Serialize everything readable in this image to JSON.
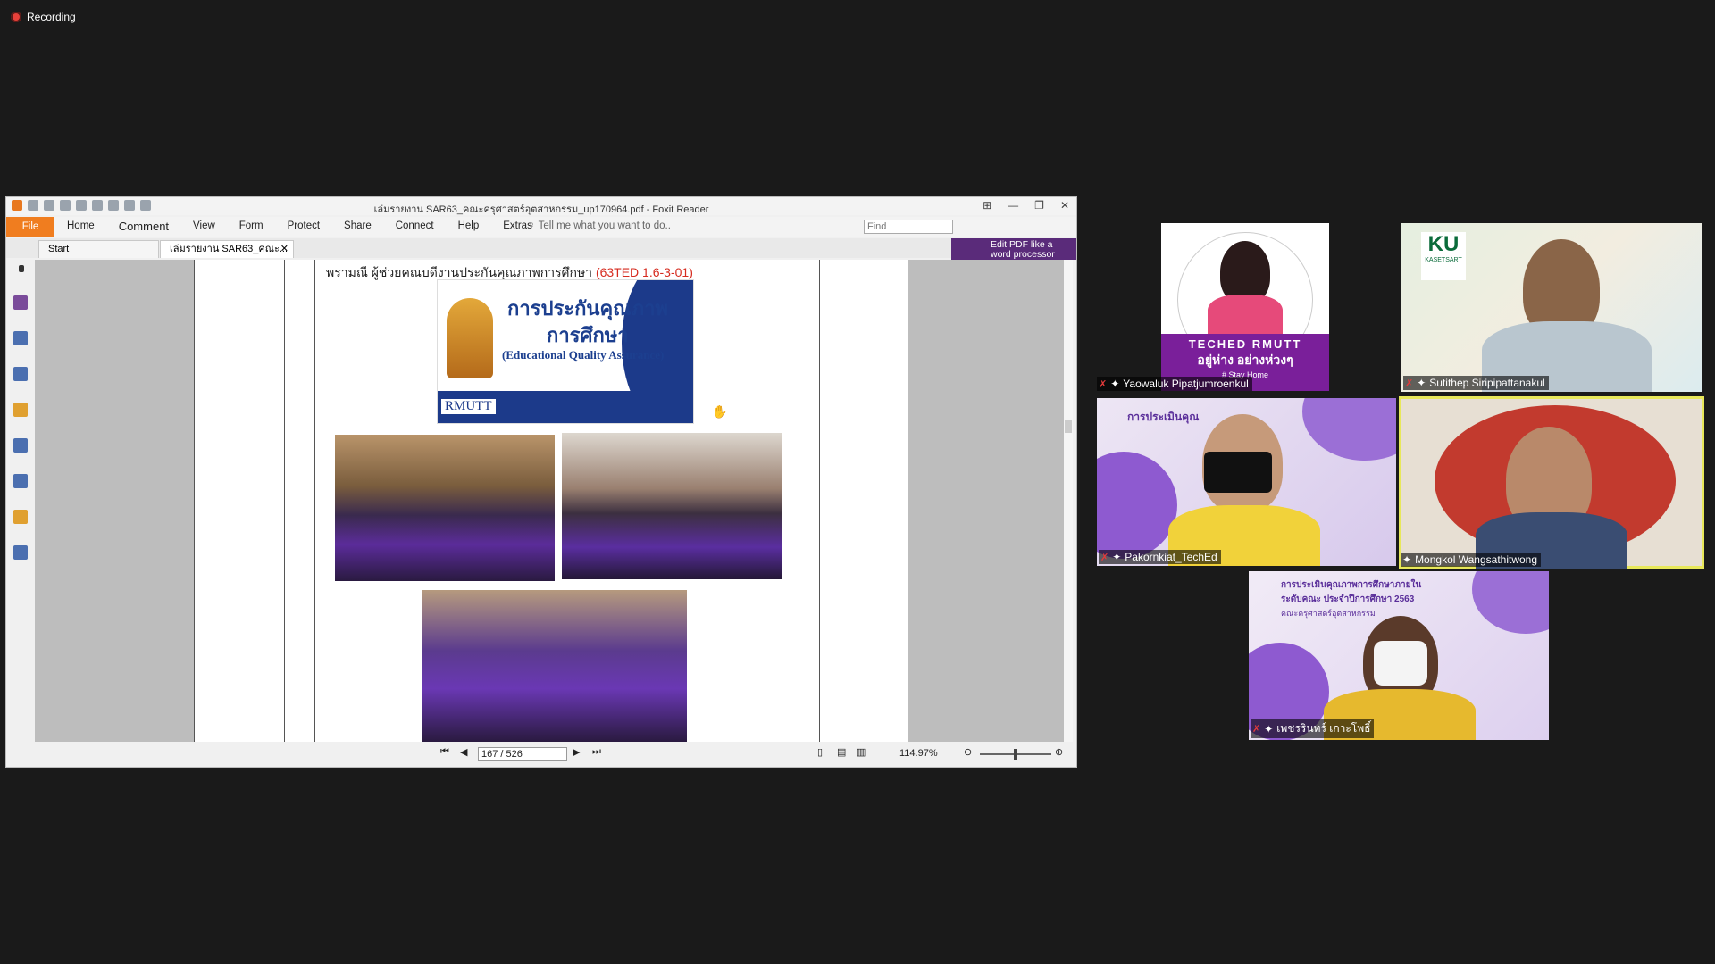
{
  "recording": {
    "label": "Recording"
  },
  "foxit": {
    "title": "เล่มรายงาน SAR63_คณะครุศาสตร์อุตสาหกรรม_up170964.pdf - Foxit Reader",
    "menu": {
      "file": "File",
      "items": [
        "Home",
        "Comment",
        "View",
        "Form",
        "Protect",
        "Share",
        "Connect",
        "Help",
        "Extras"
      ]
    },
    "tell_me": "Tell me what you want to do..",
    "find_placeholder": "Find",
    "tabs": {
      "start": "Start",
      "doc": "เล่มรายงาน SAR63_คณะ..."
    },
    "edit_pdf": {
      "line1": "Edit PDF like a",
      "line2": "word processor"
    },
    "doc": {
      "caption": "พรามณี ผู้ช่วยคณบดีงานประกันคุณภาพการศึกษา ",
      "caption_code": "(63TED 1.6-3-01)",
      "banner_title1": "การประกันคุณภาพ",
      "banner_title2": "การศึกษา",
      "banner_title3": "(Educational Quality Assurance)",
      "banner_logo": "RMUTT"
    },
    "nav": {
      "page": "167 / 526",
      "zoom": "114.97%"
    }
  },
  "participants": [
    {
      "name": "Yaowaluk Pipatjumroenkul",
      "overlay1": "TECHED RMUTT",
      "overlay2": "อยู่ห่าง อย่างห่วงๆ",
      "overlay3": "# Stay Home"
    },
    {
      "name": "Sutithep Siripipattanakul",
      "logo": "KU",
      "logo_sub": "KASETSART"
    },
    {
      "name": "Pakornkiat_TechEd",
      "bg_text": "การประเมินคุณ"
    },
    {
      "name": "Mongkol Wangsathitwong"
    },
    {
      "name": "เพชรรินทร์ เกาะโพธิ์",
      "bg_text1": "การประเมินคุณภาพการศึกษาภายใน",
      "bg_text2": "ระดับคณะ ประจำปีการศึกษา 2563",
      "bg_text3": "คณะครุศาสตร์อุตสาหกรรม"
    }
  ]
}
